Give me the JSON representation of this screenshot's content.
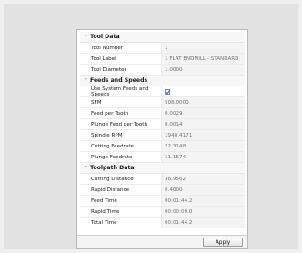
{
  "sections": [
    {
      "title": "Tool Data",
      "rows": [
        {
          "label": "Tool Number",
          "value": "1"
        },
        {
          "label": "Tool Label",
          "value": "1 FLAT ENDMILL - STANDARD"
        },
        {
          "label": "Tool Diameter",
          "value": "1.0000"
        }
      ]
    },
    {
      "title": "Feeds and Speeds",
      "rows": [
        {
          "label": "Use System Feeds and Speeds",
          "value": true
        },
        {
          "label": "SFM",
          "value": "508.0000"
        },
        {
          "label": "Feed per Tooth",
          "value": "0.0029"
        },
        {
          "label": "Plunge Feed per Tooth",
          "value": "0.0014"
        },
        {
          "label": "Spindle RPM",
          "value": "1940.4171"
        },
        {
          "label": "Cutting Feedrate",
          "value": "22.3148"
        },
        {
          "label": "Plunge Feedrate",
          "value": "11.1574"
        }
      ]
    },
    {
      "title": "Toolpath Data",
      "rows": [
        {
          "label": "Cutting Distance",
          "value": "38.9562"
        },
        {
          "label": "Rapid Distance",
          "value": "0.4000"
        },
        {
          "label": "Feed Time",
          "value": "00:01:44.2"
        },
        {
          "label": "Rapid Time",
          "value": "00:00:00.0"
        },
        {
          "label": "Total Time",
          "value": "00:01:44.2"
        }
      ]
    }
  ],
  "apply_label": "Apply"
}
